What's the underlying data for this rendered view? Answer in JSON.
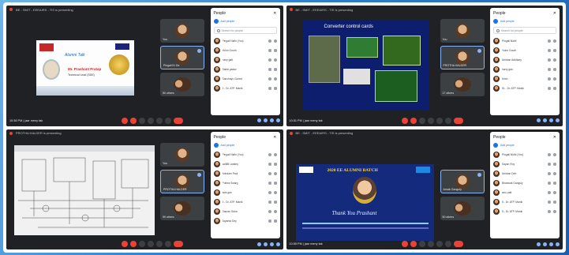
{
  "screens": [
    {
      "meeting_title": "BE - SMIT - EEEAIRS - TIS is presenting",
      "clock": "10:36 PM | jaar meny tak",
      "tiles": [
        {
          "name": "You",
          "active": false
        },
        {
          "name": "Pingali Kr De",
          "active": true
        },
        {
          "name": "50 others",
          "active": false
        }
      ],
      "panel": {
        "title": "People",
        "add_label": "Add people",
        "search_placeholder": "Search for people",
        "people": [
          "Pingali Nidhi (You)",
          "Yoinn Gourh",
          "hany galt",
          "Sahib yadav",
          "Sanchayn Guned",
          "5 - Dr. ATP. Manik"
        ]
      },
      "slide_title": "Alumni Talk",
      "slide_sub": "Mr. Prashant Pratap",
      "slide_detail": "Technical Lead (SDE)"
    },
    {
      "meeting_title": "BE - SMIT - EEEAIRS - TIS is presenting",
      "clock": "10:31 PM | jaar meny tak",
      "tiles": [
        {
          "name": "You",
          "active": false
        },
        {
          "name": "PROTHA HALDER",
          "active": true
        },
        {
          "name": "17 others",
          "active": false
        }
      ],
      "panel": {
        "title": "People",
        "add_label": "Add people",
        "search_placeholder": "Search for people",
        "people": [
          "Pingali Nidhi",
          "Yoinn Gourh",
          "Anirban Adhikary",
          "harry gan",
          "Krish",
          "51 - Dr. ATP. Manik"
        ]
      },
      "slide_title": "Converter control cards"
    },
    {
      "meeting_title": "PROTHA HALDER is presenting",
      "clock": "",
      "tiles": [
        {
          "name": "You",
          "active": false
        },
        {
          "name": "PROTHA HALDER",
          "active": true
        },
        {
          "name": "59 others",
          "active": false
        }
      ],
      "panel": {
        "title": "People",
        "add_label": "Add people",
        "search_placeholder": "",
        "people": [
          "Pingali Nidhi (You)",
          "saiBB Lahariy",
          "Arindam Paul",
          "Puthra Swarg",
          "asis gan",
          "5 - Dr. ATP. Manik",
          "Saurav Saha",
          "Jayanta Dey"
        ]
      },
      "slide_title": ""
    },
    {
      "meeting_title": "BE - SMIT - EEEAIRS - TIS is presenting",
      "clock": "10:55 PM | jaar meny tak",
      "tiles": [
        {
          "name": "Arnab Ganguly",
          "active": true
        },
        {
          "name": "50 others",
          "active": false
        }
      ],
      "panel": {
        "title": "People",
        "add_label": "Add people",
        "search_placeholder": "",
        "people": [
          "Pingali Nidhi (You)",
          "Sayan Roy",
          "Anirban Deb",
          "Bhaswati Ganguly",
          "sinu pati",
          "5 - Dr. ATP. Manik",
          "5 - Dr. ATP. Manik"
        ]
      },
      "slide_title": "2020 EE ALUMNI BATCH",
      "slide_sub": "Thank You Prashant"
    }
  ],
  "colors": {
    "meet_bg": "#202124",
    "tile_bg": "#3c4043",
    "end_call": "#ea4335",
    "accent": "#8ab4f8",
    "page_bg": "#2f7fcf"
  },
  "icons": [
    "close-icon",
    "search-icon",
    "mic-icon",
    "camera-icon",
    "end-call-icon",
    "people-icon",
    "chat-icon",
    "info-icon"
  ]
}
